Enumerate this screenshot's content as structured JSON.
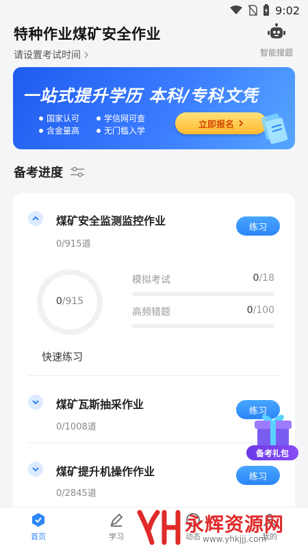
{
  "status": {
    "time": "9:02"
  },
  "header": {
    "title": "特种作业煤矿安全作业",
    "exam_time": "请设置考试时间",
    "robot_label": "智能搜题"
  },
  "banner": {
    "headline": "一站式提升学历 本科/专科文凭",
    "features": [
      "国家认可",
      "学信网可查",
      "含金量高",
      "无门槛入学"
    ],
    "cta": "立即报名"
  },
  "section": {
    "title": "备考进度"
  },
  "subjects": [
    {
      "name": "煤矿安全监测监控作业",
      "count": "0/915道",
      "button": "练习"
    },
    {
      "name": "煤矿瓦斯抽采作业",
      "count": "0/1008道",
      "button": "练习"
    },
    {
      "name": "煤矿提升机操作作业",
      "count": "0/2845道",
      "button": "练习"
    }
  ],
  "progress": {
    "ring_done": "0",
    "ring_total": "/915",
    "quick": "快速练习",
    "mock": {
      "label": "模拟考试",
      "done": "0",
      "total": "/18"
    },
    "freq": {
      "label": "高频错题",
      "done": "0",
      "total": "/100"
    }
  },
  "gift": {
    "label": "备考礼包"
  },
  "tabs": [
    {
      "label": "首页"
    },
    {
      "label": "学习"
    },
    {
      "label": "动态"
    },
    {
      "label": "我的"
    }
  ],
  "watermark": {
    "text": "永辉资源网",
    "url": "www.yhkjjj.com"
  },
  "colors": {
    "accent": "#2c86f7",
    "banner": "#1f5cf0",
    "cta": "#ffb92e"
  }
}
